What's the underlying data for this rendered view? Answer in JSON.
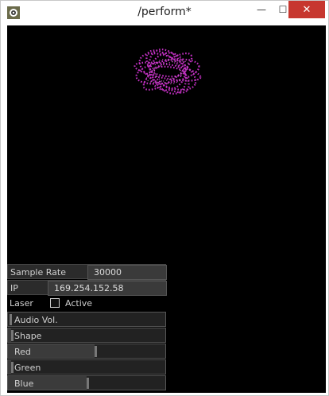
{
  "window": {
    "title": "/perform*",
    "min_label": "—",
    "max_label": "☐",
    "close_label": "✕"
  },
  "controls": {
    "sample_rate": {
      "label": "Sample Rate",
      "value": "30000"
    },
    "ip": {
      "label": "IP",
      "value": "169.254.152.58"
    },
    "laser": {
      "label": "Laser",
      "checkbox_label": "Active",
      "checked": false
    },
    "sliders": [
      {
        "label": "Audio Vol.",
        "value": 0.0
      },
      {
        "label": "Shape",
        "value": 0.02
      },
      {
        "label": "Red",
        "value": 0.55
      },
      {
        "label": "Green",
        "value": 0.02
      },
      {
        "label": "Blue",
        "value": 0.5
      }
    ]
  },
  "colors": {
    "accent_magenta": "#cc33cc",
    "canvas_bg": "#000000",
    "close_red": "#c7372f"
  }
}
